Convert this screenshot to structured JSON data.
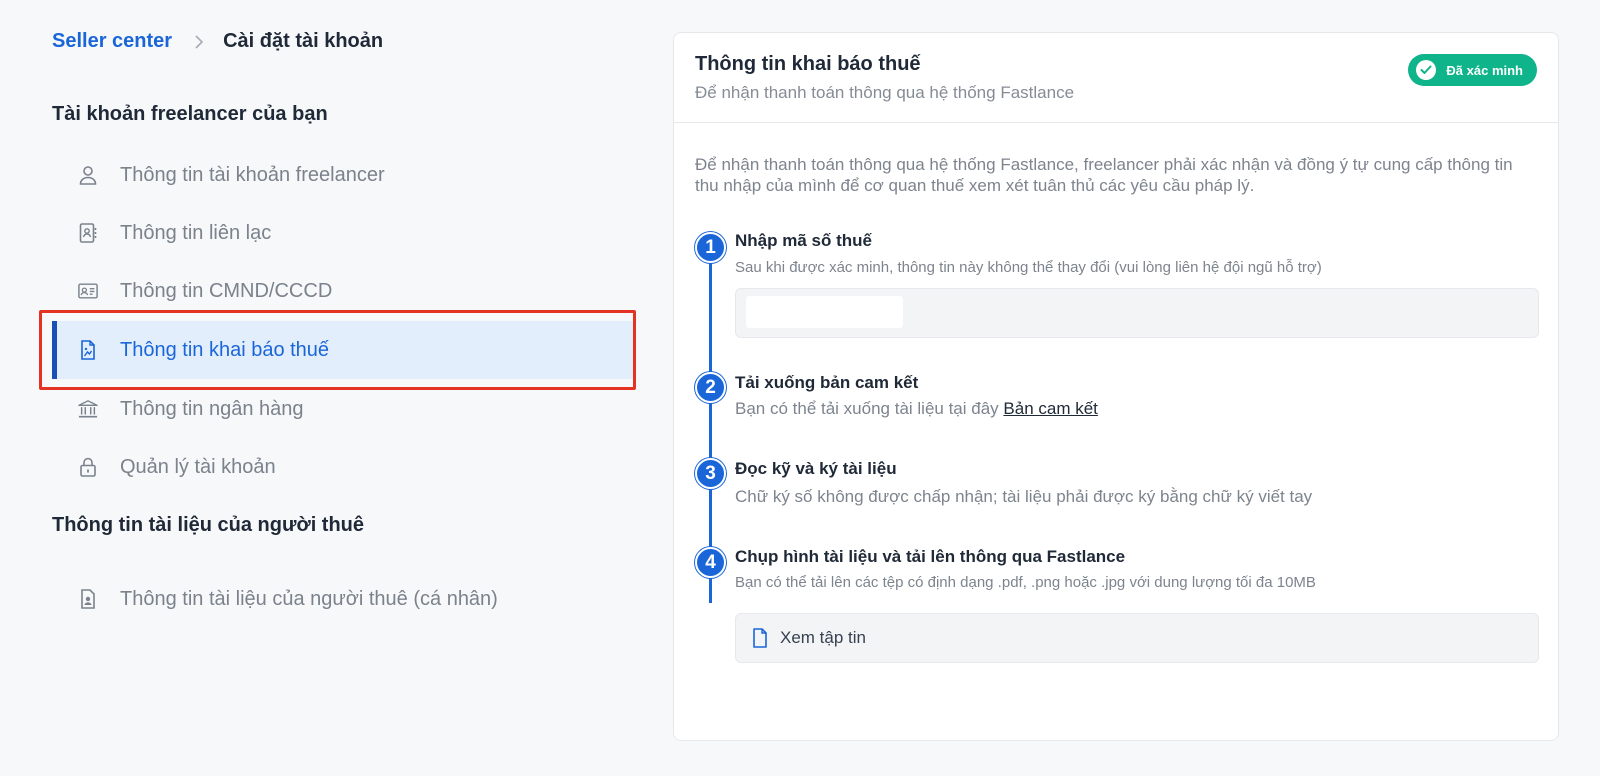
{
  "breadcrumb": {
    "root": "Seller center",
    "current": "Cài đặt tài khoản"
  },
  "sidebar": {
    "freelancer_section_title": "Tài khoản freelancer của bạn",
    "items": [
      {
        "label": "Thông tin tài khoản freelancer",
        "icon": "user-icon"
      },
      {
        "label": "Thông tin liên lạc",
        "icon": "contact-book-icon"
      },
      {
        "label": "Thông tin CMND/CCCD",
        "icon": "id-card-icon"
      },
      {
        "label": "Thông tin khai báo thuế",
        "icon": "tax-document-icon",
        "active": true
      },
      {
        "label": "Thông tin ngân hàng",
        "icon": "bank-icon"
      },
      {
        "label": "Quản lý tài khoản",
        "icon": "lock-icon"
      }
    ],
    "hirer_section_title": "Thông tin tài liệu của người thuê",
    "hirer_items": [
      {
        "label": "Thông tin tài liệu của người thuê (cá nhân)",
        "icon": "person-document-icon"
      }
    ]
  },
  "card": {
    "title": "Thông tin khai báo thuế",
    "subtitle": "Để nhận thanh toán thông qua hệ thống Fastlance",
    "badge": "Đã xác minh",
    "intro": "Để nhận thanh toán thông qua hệ thống Fastlance, freelancer phải xác nhận và đồng ý tự cung cấp thông tin thu nhập của mình để cơ quan thuế xem xét tuân thủ các yêu cầu pháp lý.",
    "steps": [
      {
        "number": "1",
        "title": "Nhập mã số thuế",
        "desc": "Sau khi được xác minh, thông tin này không thể thay đổi (vui lòng liên hệ đội ngũ hỗ trợ)"
      },
      {
        "number": "2",
        "title": "Tải xuống bản cam kết",
        "desc": "Bạn có thể tải xuống tài liệu tại đây",
        "link": "Bản cam kết"
      },
      {
        "number": "3",
        "title": "Đọc kỹ và ký tài liệu",
        "desc": "Chữ ký số không được chấp nhận; tài liệu phải được ký bằng chữ ký viết tay"
      },
      {
        "number": "4",
        "title": "Chụp hình tài liệu và tải lên thông qua Fastlance",
        "desc": "Bạn có thể tải lên các tệp có định dạng .pdf, .png hoặc .jpg với dung lượng tối đa 10MB"
      }
    ],
    "tax_input_value": "",
    "file_button": "Xem tập tin"
  },
  "colors": {
    "accent": "#1a66d9",
    "active_bg": "#e3eefc",
    "verified": "#10b48a",
    "highlight": "#e53323"
  }
}
